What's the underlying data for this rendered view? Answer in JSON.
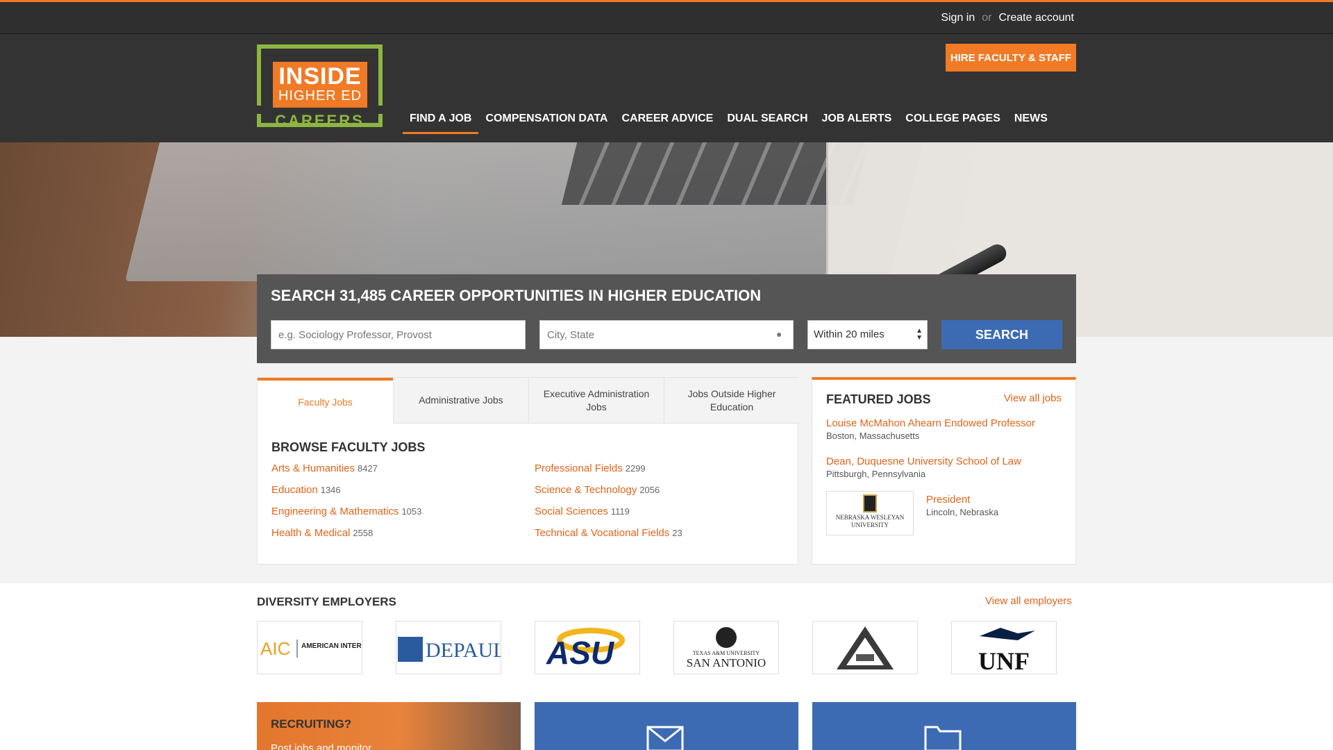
{
  "topbar": {
    "sign_in": "Sign in",
    "or": "or",
    "create_account": "Create account"
  },
  "logo": {
    "line1": "INSIDE",
    "line2": "HIGHER ED",
    "line3": "CAREERS"
  },
  "header": {
    "hire_button": "HIRE FACULTY & STAFF"
  },
  "nav": [
    {
      "label": "FIND A JOB",
      "active": true
    },
    {
      "label": "COMPENSATION DATA"
    },
    {
      "label": "CAREER ADVICE"
    },
    {
      "label": "DUAL SEARCH"
    },
    {
      "label": "JOB ALERTS"
    },
    {
      "label": "COLLEGE PAGES"
    },
    {
      "label": "NEWS"
    }
  ],
  "search": {
    "title": "SEARCH 31,485 CAREER OPPORTUNITIES IN HIGHER EDUCATION",
    "keyword_placeholder": "e.g. Sociology Professor, Provost",
    "location_placeholder": "City, State",
    "radius": "Within 20 miles",
    "button": "SEARCH"
  },
  "tabs": [
    {
      "label": "Faculty Jobs",
      "active": true
    },
    {
      "label": "Administrative Jobs"
    },
    {
      "label": "Executive Administration Jobs"
    },
    {
      "label": "Jobs Outside Higher Education"
    }
  ],
  "browse": {
    "heading": "BROWSE FACULTY JOBS",
    "categories": [
      {
        "name": "Arts & Humanities",
        "count": "8427"
      },
      {
        "name": "Professional Fields",
        "count": "2299"
      },
      {
        "name": "Education",
        "count": "1346"
      },
      {
        "name": "Science & Technology",
        "count": "2056"
      },
      {
        "name": "Engineering & Mathematics",
        "count": "1053"
      },
      {
        "name": "Social Sciences",
        "count": "1119"
      },
      {
        "name": "Health & Medical",
        "count": "2558"
      },
      {
        "name": "Technical & Vocational Fields",
        "count": "23"
      }
    ]
  },
  "featured": {
    "heading": "FEATURED JOBS",
    "view_all": "View all jobs",
    "jobs": [
      {
        "title": "Louise McMahon Ahearn Endowed Professor",
        "location": "Boston, Massachusetts"
      },
      {
        "title": "Dean, Duquesne University School of Law",
        "location": "Pittsburgh, Pennsylvania"
      },
      {
        "title": "President",
        "location": "Lincoln, Nebraska",
        "logo_text": "NEBRASKA WESLEYAN UNIVERSITY"
      }
    ]
  },
  "diversity": {
    "heading": "DIVERSITY EMPLOYERS",
    "view_all": "View all employers",
    "employers": [
      {
        "logo": "AIC",
        "text": "AMERICAN INTERNATIONAL COLLEGE"
      },
      {
        "logo": "DEPAUL",
        "text": "DEPAUL"
      },
      {
        "logo": "ASU",
        "text": "ASU"
      },
      {
        "logo": "TAMUSA",
        "text": "SAN ANTONIO",
        "text2": "TEXAS A&M UNIVERSITY"
      },
      {
        "logo": "triangle-emblem"
      },
      {
        "logo": "UNF",
        "text": "UNF"
      }
    ]
  },
  "promos": {
    "recruiting_heading": "RECRUITING?",
    "recruiting_sub": "Post jobs and monitor"
  },
  "colors": {
    "accent": "#f07a25",
    "blue": "#3d6bb3",
    "link": "#e0641a",
    "logo_green": "#8cb63f"
  }
}
